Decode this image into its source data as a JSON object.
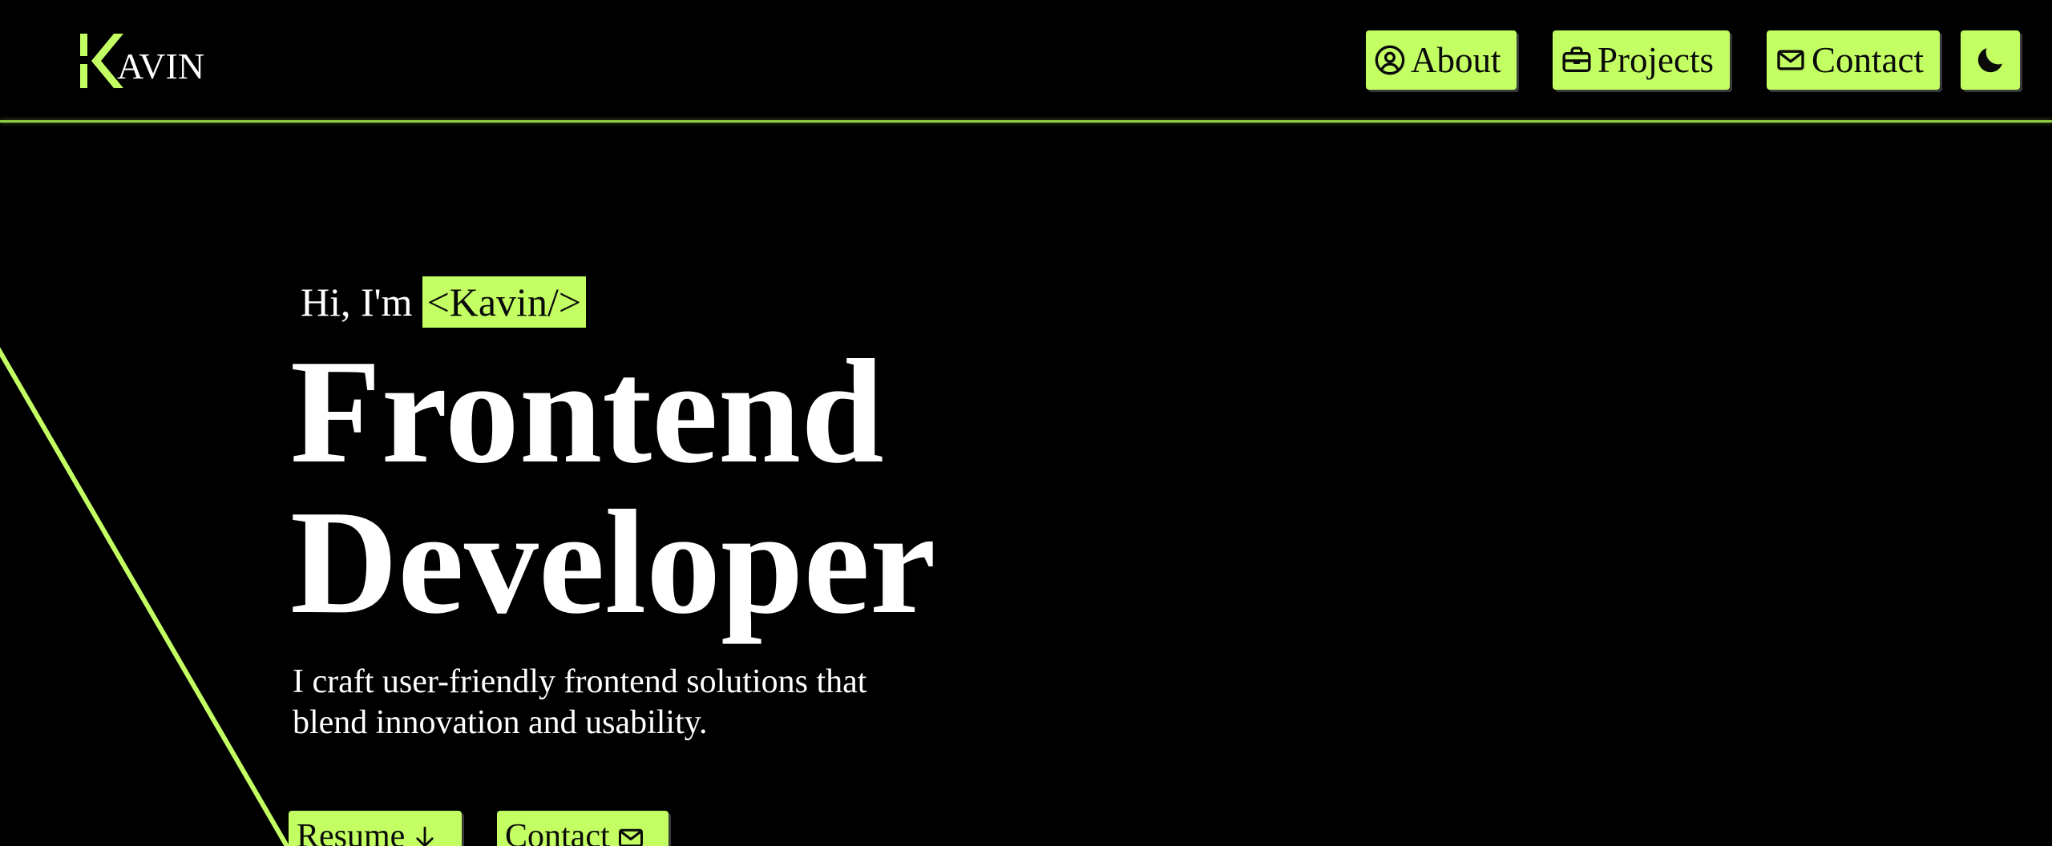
{
  "header": {
    "logo_text": "AVIN",
    "nav": {
      "about_label": "About",
      "projects_label": "Projects",
      "contact_label": "Contact"
    }
  },
  "hero": {
    "greeting": "Hi, I'm",
    "name_tag": "<Kavin/>",
    "title_line1": "Frontend",
    "title_line2": "Developer",
    "tagline": "I craft user-friendly frontend solutions that blend innovation and usability.",
    "resume_label": "Resume",
    "contact_label": "Contact"
  },
  "icons": {
    "about": "user-circle-icon",
    "projects": "briefcase-icon",
    "contact": "mail-icon",
    "theme": "moon-icon",
    "resume": "arrow-down-icon"
  },
  "colors": {
    "background": "#000000",
    "accent": "#c3ff63",
    "accent_line": "#8fcf3f",
    "text": "#ffffff",
    "button_text": "#0a0a0a"
  }
}
